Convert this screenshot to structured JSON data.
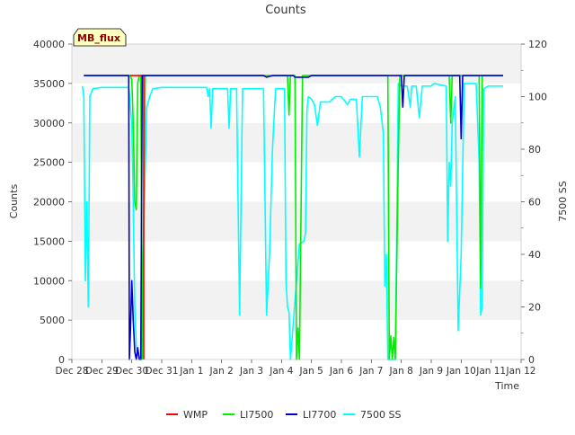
{
  "chart_data": {
    "type": "line",
    "title": "Counts",
    "xlabel": "Time",
    "ylabel": "Counts",
    "y2label": "7500 SS",
    "badge": "MB_flux",
    "ylim": [
      0,
      40000
    ],
    "y2lim": [
      0,
      120
    ],
    "xlim": [
      0,
      15
    ],
    "yticks": [
      0,
      5000,
      10000,
      15000,
      20000,
      25000,
      30000,
      35000,
      40000
    ],
    "y2ticks": [
      0,
      20,
      40,
      60,
      80,
      100,
      120
    ],
    "xticks": [
      {
        "x": 0,
        "label": "Dec 28"
      },
      {
        "x": 1,
        "label": "Dec 29"
      },
      {
        "x": 2,
        "label": "Dec 30"
      },
      {
        "x": 3,
        "label": "Dec 31"
      },
      {
        "x": 4,
        "label": "Jan 1"
      },
      {
        "x": 5,
        "label": "Jan 2"
      },
      {
        "x": 6,
        "label": "Jan 3"
      },
      {
        "x": 7,
        "label": "Jan 4"
      },
      {
        "x": 8,
        "label": "Jan 5"
      },
      {
        "x": 9,
        "label": "Jan 6"
      },
      {
        "x": 10,
        "label": "Jan 7"
      },
      {
        "x": 11,
        "label": "Jan 8"
      },
      {
        "x": 12,
        "label": "Jan 9"
      },
      {
        "x": 13,
        "label": "Jan 10"
      },
      {
        "x": 14,
        "label": "Jan 11"
      },
      {
        "x": 15,
        "label": "Jan 12"
      }
    ],
    "legend_position": "bottom",
    "grid": "horizontal bands",
    "series": [
      {
        "name": "WMP",
        "color": "#ff0000",
        "axis": "left",
        "points": [
          [
            1.95,
            36000
          ],
          [
            2.4,
            36000
          ],
          [
            2.4,
            0
          ]
        ]
      },
      {
        "name": "LI7500",
        "color": "#00ee00",
        "axis": "left",
        "points": [
          [
            0.4,
            36000
          ],
          [
            1.95,
            36000
          ],
          [
            2.0,
            35500
          ],
          [
            2.05,
            30000
          ],
          [
            2.1,
            20000
          ],
          [
            2.15,
            19000
          ],
          [
            2.2,
            35000
          ],
          [
            2.25,
            36000
          ],
          [
            2.3,
            36000
          ],
          [
            2.35,
            0
          ],
          [
            2.45,
            36000
          ],
          [
            7.2,
            36000
          ],
          [
            7.25,
            31000
          ],
          [
            7.3,
            36000
          ],
          [
            7.45,
            36000
          ],
          [
            7.5,
            0
          ],
          [
            7.55,
            4000
          ],
          [
            7.6,
            0
          ],
          [
            7.7,
            36000
          ],
          [
            10.55,
            36000
          ],
          [
            10.6,
            0
          ],
          [
            10.65,
            3000
          ],
          [
            10.7,
            0
          ],
          [
            10.75,
            2800
          ],
          [
            10.8,
            0
          ],
          [
            10.9,
            25000
          ],
          [
            10.95,
            36000
          ],
          [
            12.6,
            36000
          ],
          [
            12.65,
            30000
          ],
          [
            12.7,
            36000
          ],
          [
            13.6,
            36000
          ],
          [
            13.65,
            9000
          ],
          [
            13.7,
            36000
          ],
          [
            14.4,
            36000
          ]
        ]
      },
      {
        "name": "LI7700",
        "color": "#0000cc",
        "axis": "left",
        "points": [
          [
            0.4,
            36000
          ],
          [
            1.9,
            36000
          ],
          [
            1.92,
            0
          ],
          [
            1.95,
            3000
          ],
          [
            2.0,
            10000
          ],
          [
            2.05,
            5000
          ],
          [
            2.1,
            1000
          ],
          [
            2.15,
            0
          ],
          [
            2.2,
            1500
          ],
          [
            2.25,
            0
          ],
          [
            2.3,
            0
          ],
          [
            2.35,
            36000
          ],
          [
            6.4,
            36000
          ],
          [
            6.5,
            35800
          ],
          [
            6.7,
            36000
          ],
          [
            7.4,
            36000
          ],
          [
            7.45,
            35800
          ],
          [
            7.9,
            35800
          ],
          [
            8.0,
            36000
          ],
          [
            11.0,
            36000
          ],
          [
            11.05,
            32000
          ],
          [
            11.1,
            36000
          ],
          [
            12.95,
            36000
          ],
          [
            13.0,
            28000
          ],
          [
            13.05,
            36000
          ],
          [
            14.4,
            36000
          ]
        ]
      },
      {
        "name": "7500 SS",
        "color": "#00ffff",
        "axis": "right",
        "points": [
          [
            0.35,
            104
          ],
          [
            0.4,
            100
          ],
          [
            0.45,
            30
          ],
          [
            0.5,
            60
          ],
          [
            0.55,
            20
          ],
          [
            0.6,
            100
          ],
          [
            0.7,
            103
          ],
          [
            1.0,
            103.5
          ],
          [
            1.9,
            103.5
          ],
          [
            2.0,
            90
          ],
          [
            2.05,
            60
          ],
          [
            2.1,
            20
          ],
          [
            2.15,
            5
          ],
          [
            2.2,
            2
          ],
          [
            2.3,
            0
          ],
          [
            2.4,
            50
          ],
          [
            2.5,
            96
          ],
          [
            2.6,
            100
          ],
          [
            2.7,
            103
          ],
          [
            3.0,
            103.5
          ],
          [
            4.5,
            103.5
          ],
          [
            4.55,
            100
          ],
          [
            4.6,
            103
          ],
          [
            4.65,
            88
          ],
          [
            4.7,
            103
          ],
          [
            5.2,
            103
          ],
          [
            5.25,
            88
          ],
          [
            5.3,
            103
          ],
          [
            5.5,
            103
          ],
          [
            5.55,
            60
          ],
          [
            5.6,
            17
          ],
          [
            5.65,
            60
          ],
          [
            5.7,
            103
          ],
          [
            6.4,
            103
          ],
          [
            6.45,
            60
          ],
          [
            6.5,
            17
          ],
          [
            6.6,
            40
          ],
          [
            6.7,
            80
          ],
          [
            6.8,
            103
          ],
          [
            7.1,
            103
          ],
          [
            7.15,
            30
          ],
          [
            7.2,
            20
          ],
          [
            7.25,
            18
          ],
          [
            7.3,
            0
          ],
          [
            7.6,
            44
          ],
          [
            7.75,
            45
          ],
          [
            7.8,
            48
          ],
          [
            7.85,
            95
          ],
          [
            7.9,
            100
          ],
          [
            8.0,
            99
          ],
          [
            8.1,
            97
          ],
          [
            8.2,
            89
          ],
          [
            8.3,
            98
          ],
          [
            8.6,
            98
          ],
          [
            8.8,
            100
          ],
          [
            9.0,
            100
          ],
          [
            9.2,
            97
          ],
          [
            9.3,
            99
          ],
          [
            9.5,
            99
          ],
          [
            9.6,
            77
          ],
          [
            9.7,
            100
          ],
          [
            10.0,
            100
          ],
          [
            10.2,
            100
          ],
          [
            10.3,
            96
          ],
          [
            10.4,
            86
          ],
          [
            10.45,
            28
          ],
          [
            10.5,
            40
          ],
          [
            10.55,
            0
          ],
          [
            10.8,
            0
          ],
          [
            10.85,
            50
          ],
          [
            10.9,
            105
          ],
          [
            11.0,
            104
          ],
          [
            11.2,
            104
          ],
          [
            11.3,
            96
          ],
          [
            11.35,
            104
          ],
          [
            11.5,
            104
          ],
          [
            11.6,
            92
          ],
          [
            11.7,
            104
          ],
          [
            12.0,
            104
          ],
          [
            12.1,
            105
          ],
          [
            12.5,
            104
          ],
          [
            12.55,
            45
          ],
          [
            12.6,
            75
          ],
          [
            12.65,
            66
          ],
          [
            12.7,
            90
          ],
          [
            12.8,
            100
          ],
          [
            12.9,
            11
          ],
          [
            13.0,
            40
          ],
          [
            13.1,
            105
          ],
          [
            13.5,
            105
          ],
          [
            13.6,
            75
          ],
          [
            13.65,
            17
          ],
          [
            13.7,
            20
          ],
          [
            13.75,
            103
          ],
          [
            13.9,
            104
          ],
          [
            14.4,
            104
          ]
        ]
      }
    ]
  }
}
